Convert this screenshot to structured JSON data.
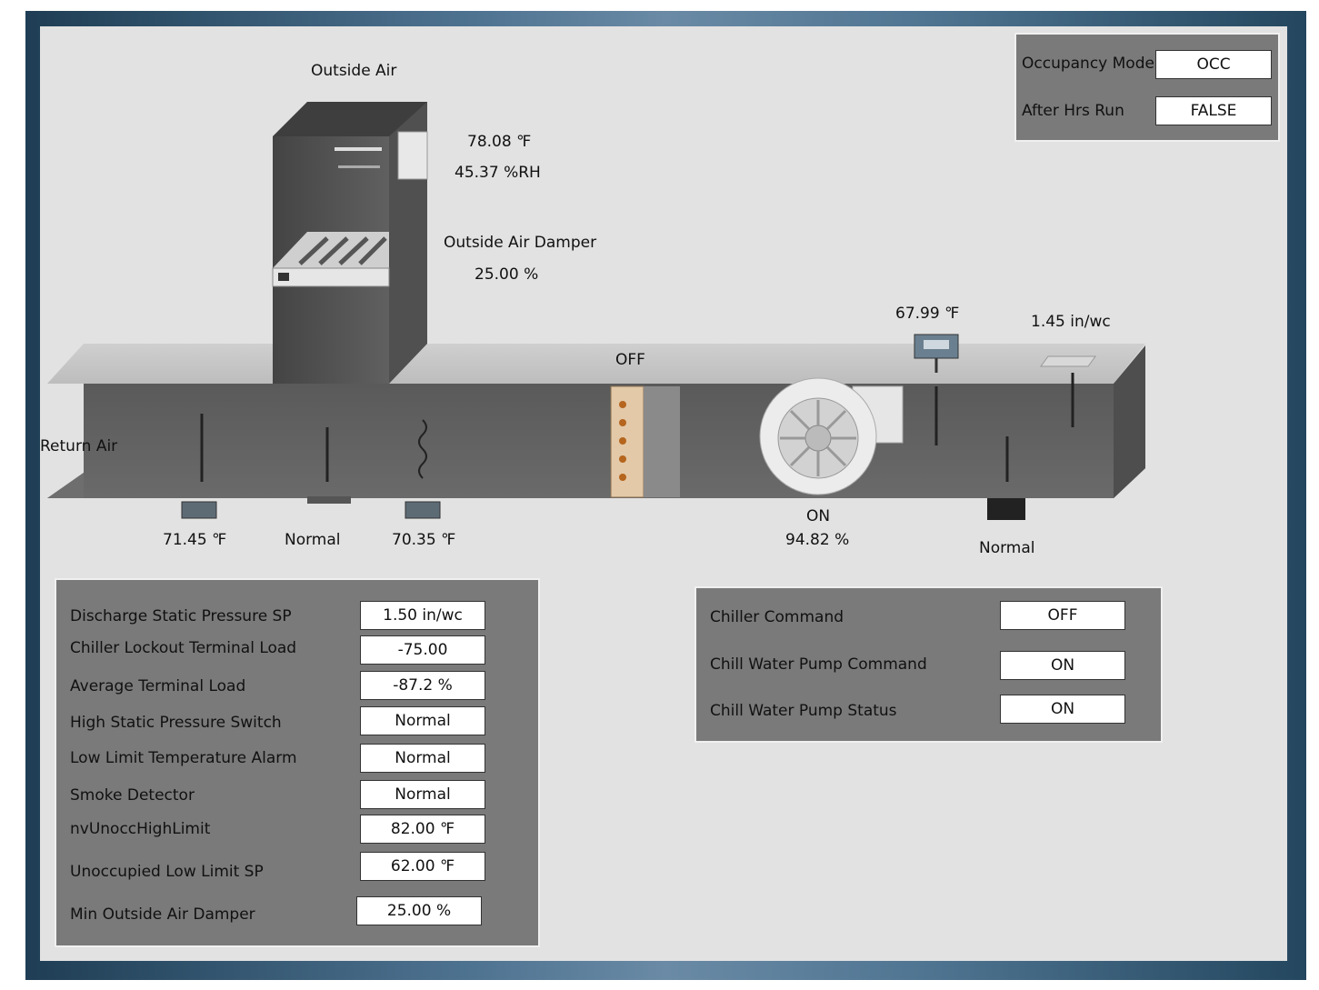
{
  "diagram": {
    "outside_air_label": "Outside Air",
    "oa_temp": "78.08 ℉",
    "oa_humidity": "45.37 %RH",
    "oa_damper_label": "Outside Air Damper",
    "oa_damper_value": "25.00 %",
    "coil_status": "OFF",
    "discharge_temp": "67.99 ℉",
    "static_pressure": "1.45 in/wc",
    "return_air_label": "Return Air",
    "return_temp": "71.45 ℉",
    "filter_status": "Normal",
    "mixed_temp": "70.35 ℉",
    "fan_status": "ON",
    "fan_speed": "94.82 %",
    "smoke_status": "Normal"
  },
  "occupancy": {
    "mode_label": "Occupancy Mode",
    "mode_value": "OCC",
    "after_hrs_label": "After Hrs Run",
    "after_hrs_value": "FALSE"
  },
  "settings": [
    {
      "label": "Discharge Static Pressure SP",
      "value": "1.50 in/wc"
    },
    {
      "label": "Chiller Lockout Terminal Load",
      "value": "-75.00"
    },
    {
      "label": "Average Terminal Load",
      "value": "-87.2 %"
    },
    {
      "label": "High Static Pressure Switch",
      "value": "Normal"
    },
    {
      "label": "Low Limit Temperature Alarm",
      "value": "Normal"
    },
    {
      "label": "Smoke Detector",
      "value": "Normal"
    },
    {
      "label": "nvUnoccHighLimit",
      "value": "82.00 ℉"
    },
    {
      "label": "Unoccupied Low Limit SP",
      "value": "62.00 ℉"
    },
    {
      "label": "Min Outside Air Damper",
      "value": "25.00 %"
    }
  ],
  "chiller": [
    {
      "label": "Chiller Command",
      "value": "OFF"
    },
    {
      "label": "Chill Water Pump Command",
      "value": "ON"
    },
    {
      "label": "Chill Water Pump Status",
      "value": "ON"
    }
  ]
}
